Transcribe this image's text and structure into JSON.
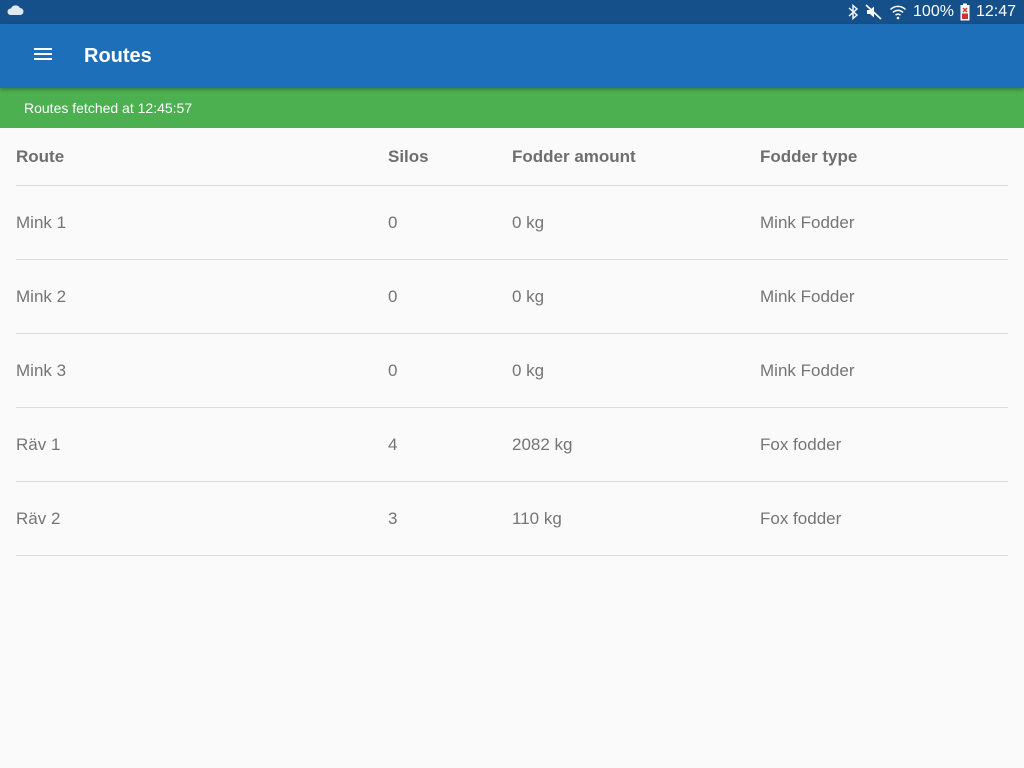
{
  "status_bar": {
    "battery_percent": "100%",
    "time": "12:47"
  },
  "app_bar": {
    "title": "Routes"
  },
  "notice": {
    "text": "Routes fetched at 12:45:57"
  },
  "table": {
    "columns": [
      "Route",
      "Silos",
      "Fodder amount",
      "Fodder type"
    ],
    "rows": [
      [
        "Mink 1",
        "0",
        "0 kg",
        "Mink Fodder"
      ],
      [
        "Mink 2",
        "0",
        "0 kg",
        "Mink Fodder"
      ],
      [
        "Mink 3",
        "0",
        "0 kg",
        "Mink Fodder"
      ],
      [
        "Räv 1",
        "4",
        "2082 kg",
        "Fox fodder"
      ],
      [
        "Räv 2",
        "3",
        "110 kg",
        "Fox fodder"
      ]
    ]
  },
  "colors": {
    "status_bar": "#15508b",
    "app_bar": "#1e6fba",
    "notice_bar": "#4caf50",
    "background": "#fafafa"
  }
}
